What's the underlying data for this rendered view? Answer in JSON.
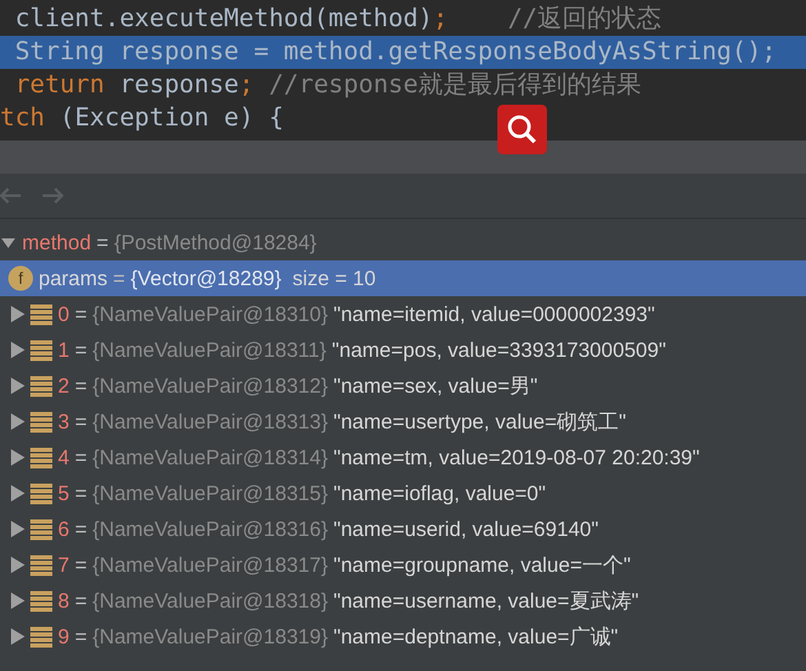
{
  "editor": {
    "lines": [
      {
        "selected": false,
        "segments": [
          {
            "kind": "code",
            "text": " client.executeMethod(method)"
          },
          {
            "kind": "keyword",
            "text": ";"
          },
          {
            "kind": "comment",
            "text": "    //返回的状态"
          }
        ]
      },
      {
        "selected": true,
        "segments": [
          {
            "kind": "code",
            "text": " String response = method.getResponseBodyAsString();"
          }
        ]
      },
      {
        "selected": false,
        "segments": [
          {
            "kind": "keyword",
            "text": " return"
          },
          {
            "kind": "code",
            "text": " response"
          },
          {
            "kind": "keyword",
            "text": ";"
          },
          {
            "kind": "comment",
            "text": " //response就是最后得到的结果"
          }
        ]
      },
      {
        "selected": false,
        "segments": [
          {
            "kind": "keyword",
            "text": "tch"
          },
          {
            "kind": "code",
            "text": " (Exception e) {"
          }
        ]
      }
    ]
  },
  "variables": [
    {
      "kind": "object",
      "name": "method",
      "equals": "=",
      "ref": "{PostMethod@18284}",
      "selected": false,
      "expanded": true,
      "children": [
        {
          "kind": "field",
          "badge": "f",
          "name": "params",
          "equals": "=",
          "ref": "{Vector@18289}",
          "extra": "size = 10",
          "selected": true,
          "expanded": true,
          "children": [
            {
              "kind": "item",
              "name": "0",
              "equals": "=",
              "ref": "{NameValuePair@18310}",
              "value": "\"name=itemid, value=0000002393\"",
              "selected": false,
              "expanded": false
            },
            {
              "kind": "item",
              "name": "1",
              "equals": "=",
              "ref": "{NameValuePair@18311}",
              "value": "\"name=pos, value=3393173000509\"",
              "selected": false,
              "expanded": false
            },
            {
              "kind": "item",
              "name": "2",
              "equals": "=",
              "ref": "{NameValuePair@18312}",
              "value": "\"name=sex, value=男\"",
              "selected": false,
              "expanded": false
            },
            {
              "kind": "item",
              "name": "3",
              "equals": "=",
              "ref": "{NameValuePair@18313}",
              "value": "\"name=usertype, value=砌筑工\"",
              "selected": false,
              "expanded": false
            },
            {
              "kind": "item",
              "name": "4",
              "equals": "=",
              "ref": "{NameValuePair@18314}",
              "value": "\"name=tm, value=2019-08-07 20:20:39\"",
              "selected": false,
              "expanded": false
            },
            {
              "kind": "item",
              "name": "5",
              "equals": "=",
              "ref": "{NameValuePair@18315}",
              "value": "\"name=ioflag, value=0\"",
              "selected": false,
              "expanded": false
            },
            {
              "kind": "item",
              "name": "6",
              "equals": "=",
              "ref": "{NameValuePair@18316}",
              "value": "\"name=userid, value=69140\"",
              "selected": false,
              "expanded": false
            },
            {
              "kind": "item",
              "name": "7",
              "equals": "=",
              "ref": "{NameValuePair@18317}",
              "value": "\"name=groupname, value=一个\"",
              "selected": false,
              "expanded": false
            },
            {
              "kind": "item",
              "name": "8",
              "equals": "=",
              "ref": "{NameValuePair@18318}",
              "value": "\"name=username, value=夏武涛\"",
              "selected": false,
              "expanded": false
            },
            {
              "kind": "item",
              "name": "9",
              "equals": "=",
              "ref": "{NameValuePair@18319}",
              "value": "\"name=deptname, value=广诚\"",
              "selected": false,
              "expanded": false
            }
          ]
        }
      ]
    }
  ]
}
